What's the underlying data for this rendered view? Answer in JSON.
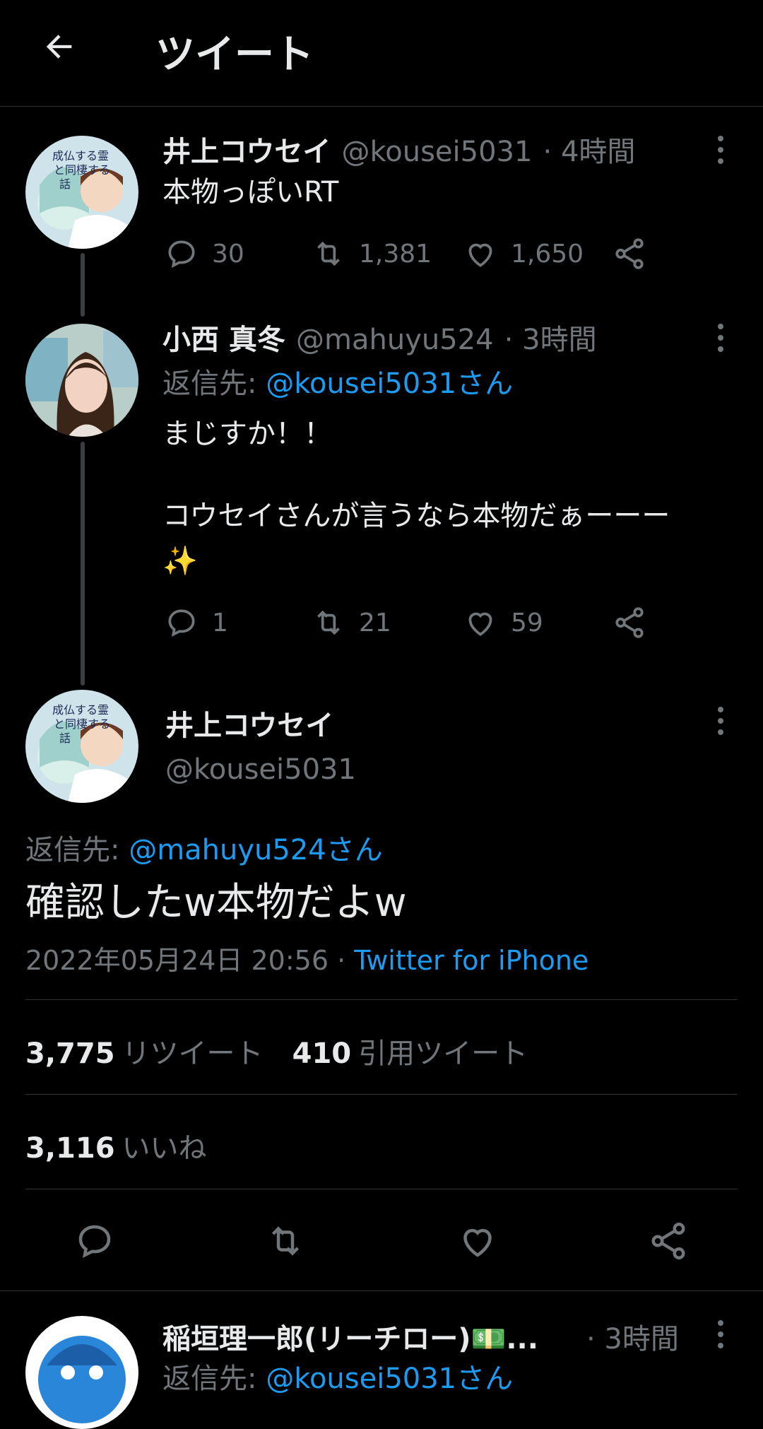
{
  "header": {
    "title": "ツイート",
    "back_icon": "arrow-left-icon"
  },
  "tweets": [
    {
      "name": "井上コウセイ",
      "handle": "@kousei5031",
      "time": "· 4時間",
      "text": "本物っぽいRT",
      "replies": "30",
      "retweets": "1,381",
      "likes": "1,650",
      "avatar_text": "成仏する霊と同棲する話"
    },
    {
      "name": "小西 真冬",
      "handle": "@mahuyu524",
      "time": "· 3時間",
      "reply_prefix": "返信先:",
      "reply_to": "@kousei5031さん",
      "text_line1": "まじすか！！",
      "text_line2": "コウセイさんが言うなら本物だぁーーー",
      "text_line3": "✨",
      "replies": "1",
      "retweets": "21",
      "likes": "59"
    }
  ],
  "main_tweet": {
    "name": "井上コウセイ",
    "handle": "@kousei5031",
    "reply_prefix": "返信先:",
    "reply_to": "@mahuyu524さん",
    "text": "確認したw本物だよw",
    "timestamp": "2022年05月24日 20:56 ·",
    "source": "Twitter for iPhone",
    "retweet_count": "3,775",
    "retweet_label": "リツイート",
    "quote_count": "410",
    "quote_label": "引用ツイート",
    "like_count": "3,116",
    "like_label": "いいね"
  },
  "next_reply": {
    "name": "稲垣理一郎(リーチロー)💵...",
    "time": "· 3時間",
    "reply_prefix": "返信先:",
    "reply_to": "@kousei5031さん"
  },
  "colors": {
    "background": "#000000",
    "text": "#e7e9ea",
    "muted": "#71767b",
    "link": "#1d9bf0"
  }
}
